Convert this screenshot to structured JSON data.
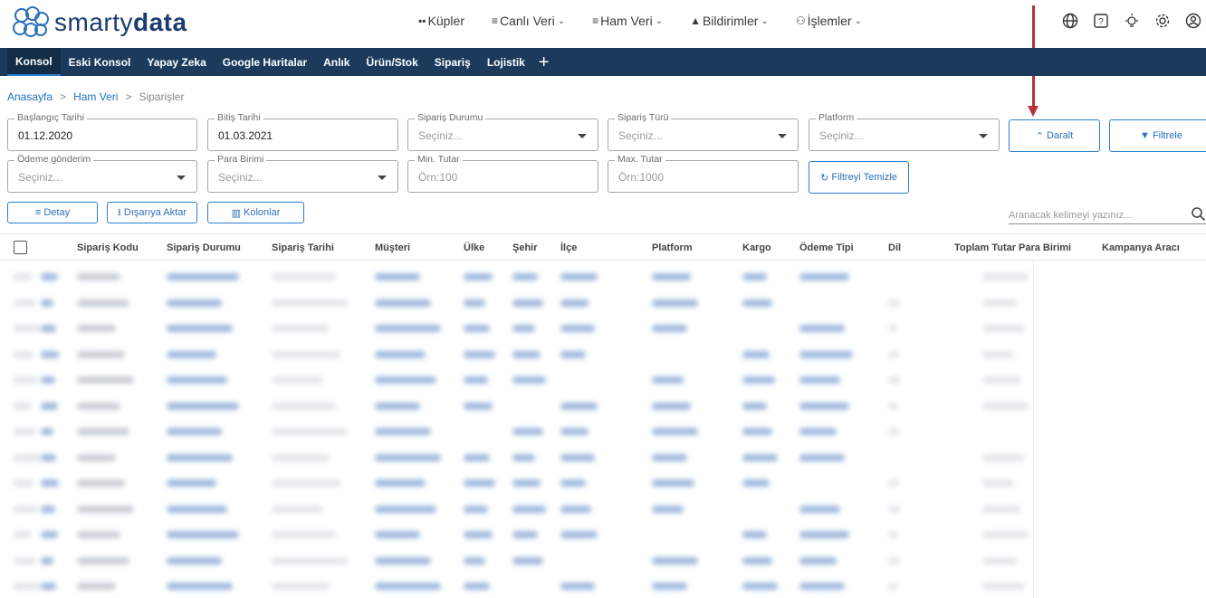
{
  "brand": {
    "name_light": "smarty",
    "name_bold": "data"
  },
  "topnav": [
    {
      "label": "Küpler",
      "icon": "cubes-icon",
      "dropdown": false
    },
    {
      "label": "Canlı Veri",
      "icon": "lines-icon",
      "dropdown": true
    },
    {
      "label": "Ham Veri",
      "icon": "lines-icon",
      "dropdown": true
    },
    {
      "label": "Bildirimler",
      "icon": "bell-icon",
      "dropdown": true
    },
    {
      "label": "İşlemler",
      "icon": "users-icon",
      "dropdown": true
    }
  ],
  "top_icons": [
    "globe-icon",
    "help-icon",
    "bulb-icon",
    "gear-icon",
    "user-icon"
  ],
  "navbar": {
    "items": [
      "Konsol",
      "Eski Konsol",
      "Yapay Zeka",
      "Google Haritalar",
      "Anlık",
      "Ürün/Stok",
      "Sipariş",
      "Lojistik"
    ],
    "active": "Konsol",
    "plus": "+"
  },
  "breadcrumb": {
    "home": "Anasayfa",
    "parent": "Ham Veri",
    "current": "Siparişler",
    "sep": ">"
  },
  "filters": {
    "start_date": {
      "label": "Başlangıç Tarihi",
      "value": "01.12.2020"
    },
    "end_date": {
      "label": "Bitiş Tarihi",
      "value": "01.03.2021"
    },
    "order_status": {
      "label": "Sipariş Durumu",
      "placeholder": "Seçiniz..."
    },
    "order_type": {
      "label": "Sipariş Türü",
      "placeholder": "Seçiniz..."
    },
    "platform": {
      "label": "Platform",
      "placeholder": "Seçiniz..."
    },
    "payment": {
      "label": "Ödeme gönderim",
      "placeholder": "Seçiniz..."
    },
    "currency": {
      "label": "Para Birimi",
      "placeholder": "Seçiniz..."
    },
    "min_amount": {
      "label": "Min. Tutar",
      "placeholder": "Örn:100"
    },
    "max_amount": {
      "label": "Max. Tutar",
      "placeholder": "Örn:1000"
    },
    "collapse_label": "Daralt",
    "filter_label": "Filtrele",
    "clear_label": "Filtreyi Temizle"
  },
  "actions": {
    "detail": "Detay",
    "export": "Dışarıya Aktar",
    "columns": "Kolonlar"
  },
  "search": {
    "placeholder": "Aranacak kelimeyi yazınız..."
  },
  "table": {
    "columns": [
      "Sipariş Kodu",
      "Sipariş Durumu",
      "Sipariş Tarihi",
      "Müşteri",
      "Ülke",
      "Şehir",
      "İlçe",
      "Platform",
      "Kargo",
      "Ödeme Tipi",
      "Dil",
      "Toplam Tutar",
      "Para Birimi",
      "Kampanya Aracı"
    ]
  },
  "colors": {
    "navbar": "#1b3a5c",
    "accent": "#2a7fcf",
    "annotation": "#b5343b"
  }
}
